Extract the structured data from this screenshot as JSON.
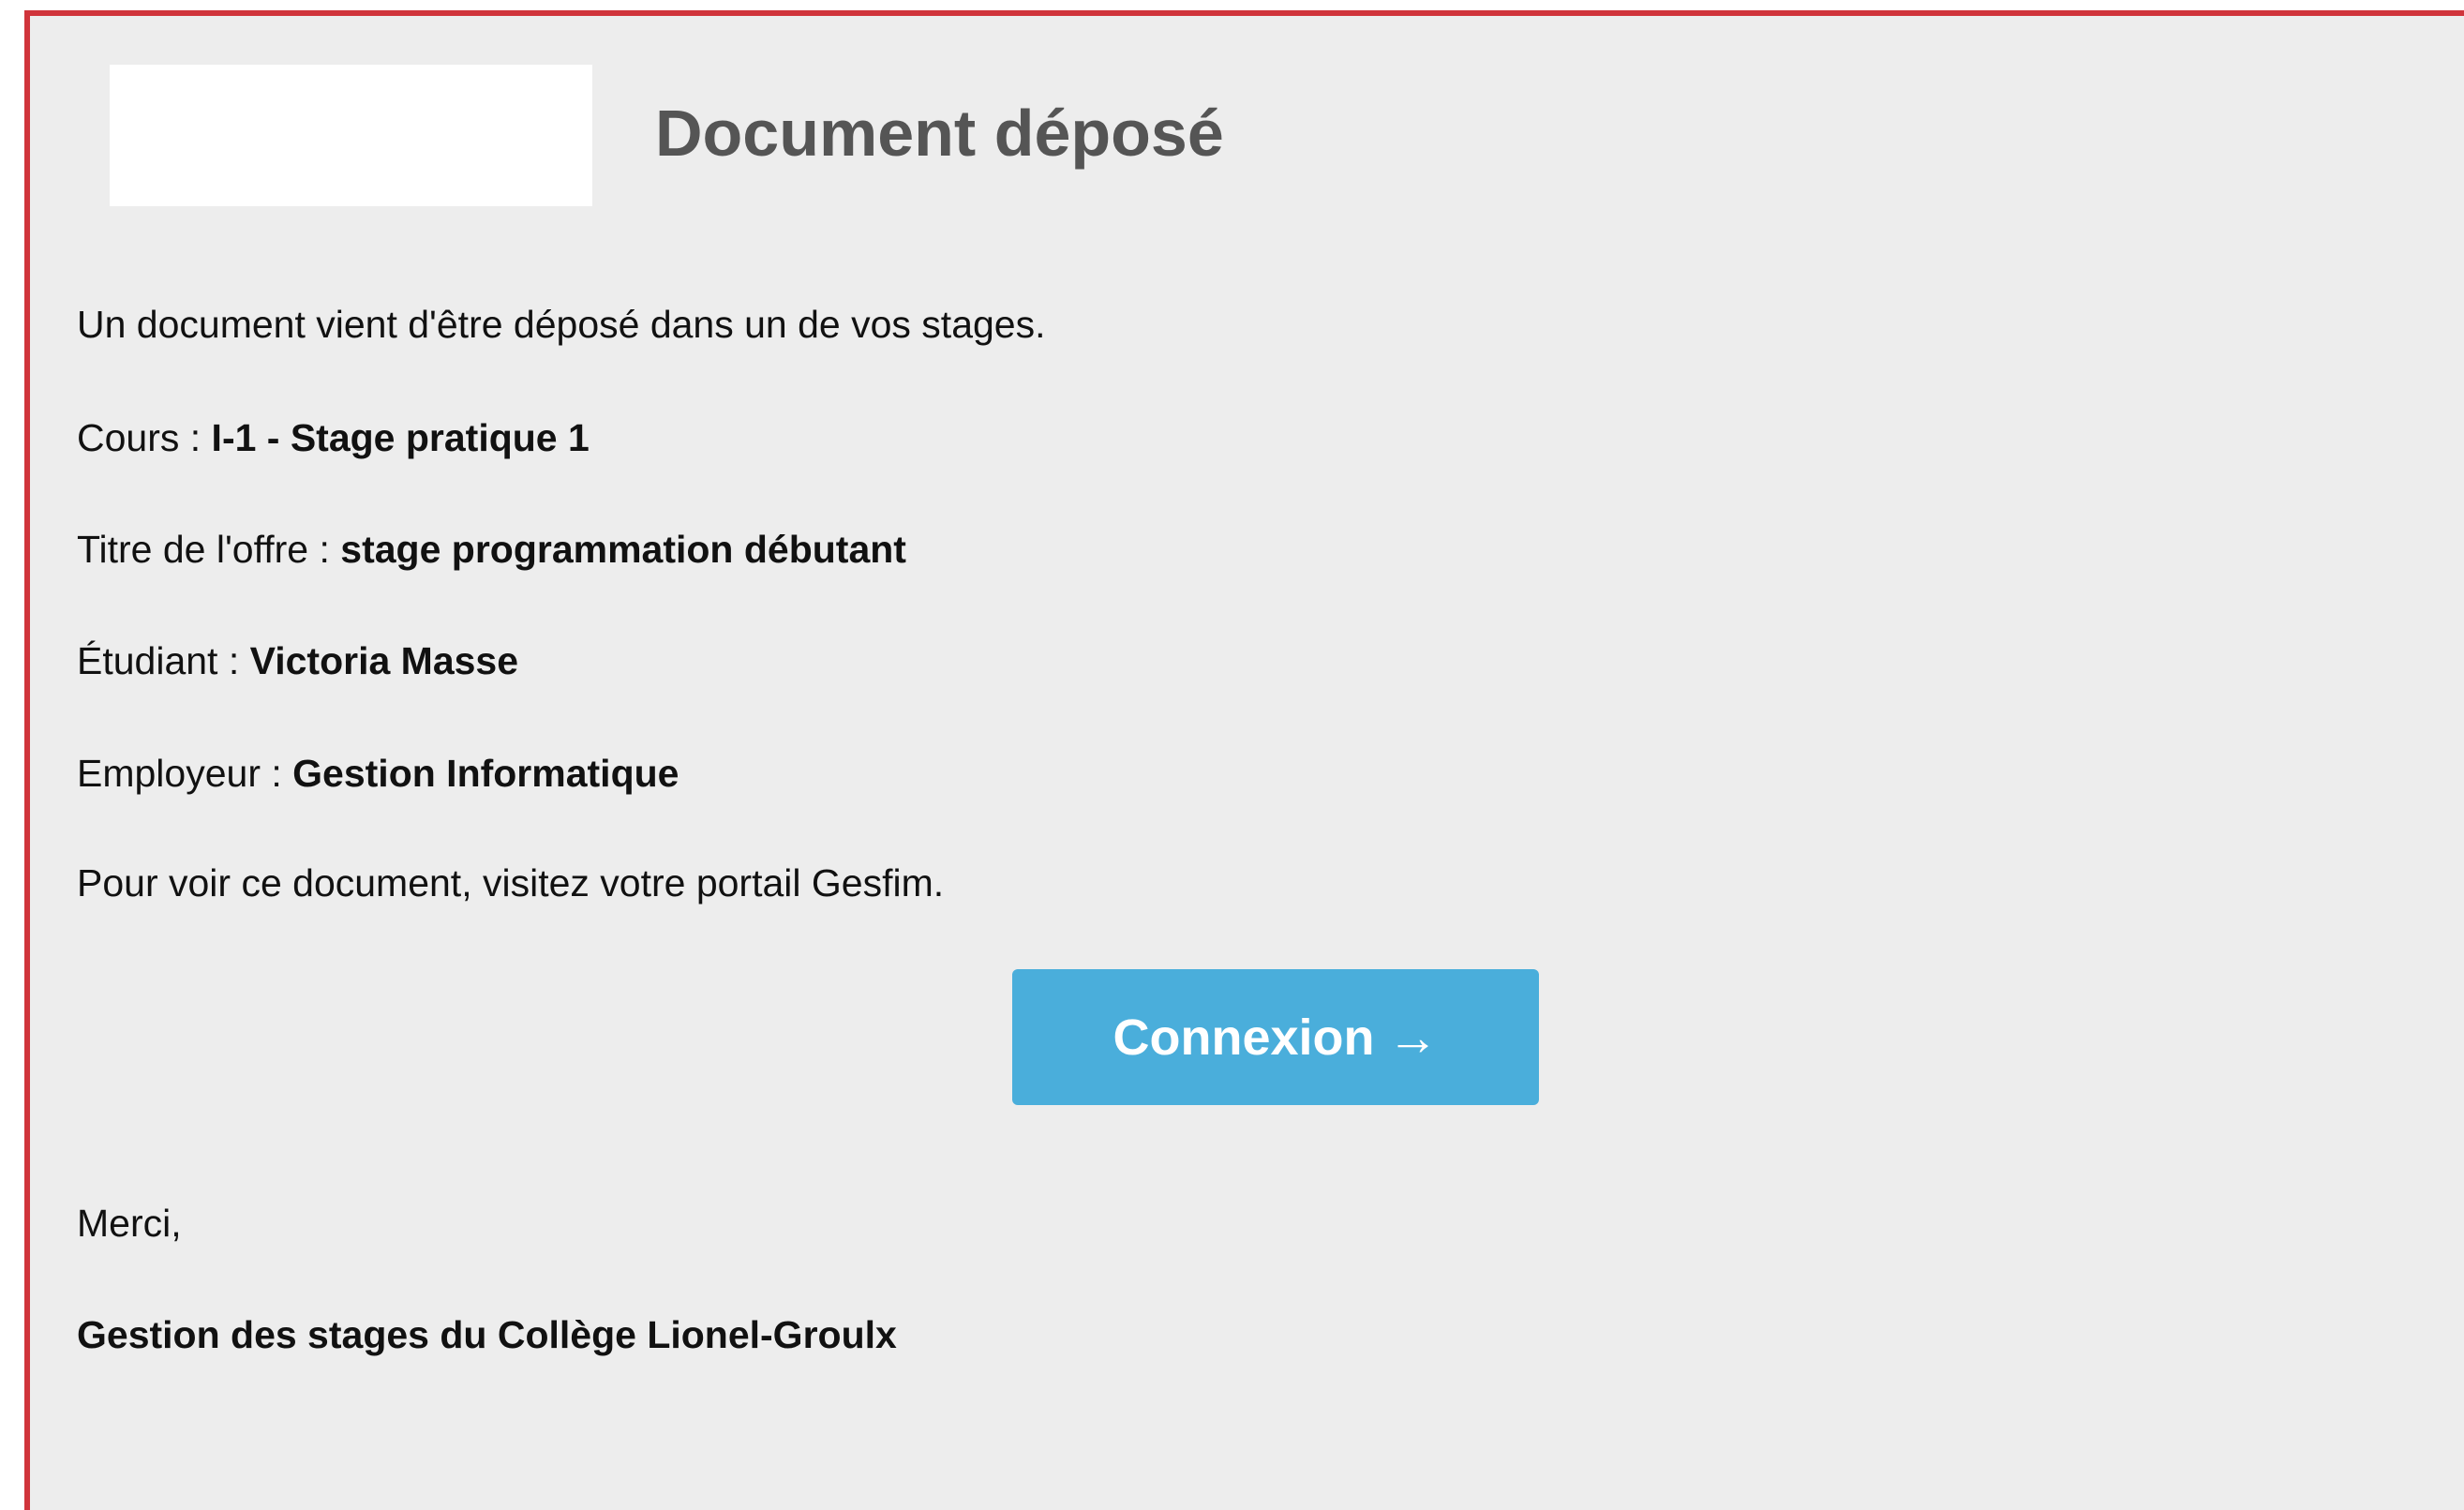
{
  "email": {
    "title": "Document déposé",
    "intro": "Un document vient d'être déposé dans un de vos stages.",
    "fields": [
      {
        "label": "Cours : ",
        "value": "I-1 - Stage pratique 1"
      },
      {
        "label": "Titre de l'offre : ",
        "value": "stage programmation débutant"
      },
      {
        "label": "Étudiant : ",
        "value": "Victoria Masse"
      },
      {
        "label": "Employeur : ",
        "value": "Gestion Informatique"
      }
    ],
    "instruction": "Pour voir ce document, visitez votre portail Gesfim.",
    "button": {
      "label": "Connexion",
      "arrow": "→"
    },
    "closing": "Merci,",
    "signature": "Gestion des stages du Collège Lionel-Groulx"
  },
  "colors": {
    "border": "#d0343b",
    "background": "#ededed",
    "button": "#4aaedb",
    "title": "#555555"
  }
}
